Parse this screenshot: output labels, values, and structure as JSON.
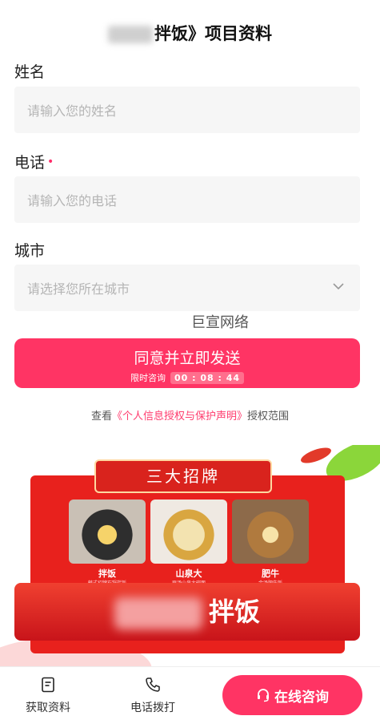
{
  "header": {
    "title": "拌饭》项目资料"
  },
  "form": {
    "name_label": "姓名",
    "name_placeholder": "请输入您的姓名",
    "phone_label": "电话",
    "required_mark": "•",
    "phone_placeholder": "请输入您的电话",
    "city_label": "城市",
    "city_placeholder": "请选择您所在城市"
  },
  "watermark": "巨宣网络",
  "submit": {
    "label": "同意并立即发送",
    "countdown_prefix": "限时咨询",
    "countdown": "00 : 08 : 44"
  },
  "privacy": {
    "prefix": "查看",
    "link": "《个人信息授权与保护声明》",
    "suffix": "授权范围"
  },
  "promo": {
    "banner": "三大招牌",
    "items": [
      {
        "label": "拌饭",
        "sub": "韩式招牌石锅拌饭"
      },
      {
        "label": "山泉大",
        "sub": "原汤山泉大碗面"
      },
      {
        "label": "肥牛",
        "sub": "金汤肥牛饭"
      }
    ],
    "big_label": "拌饭"
  },
  "tabbar": {
    "materials": "获取资料",
    "call": "电话拨打",
    "consult": "在线咨询"
  },
  "colors": {
    "accent": "#ff3464",
    "promo_red": "#e8211d"
  }
}
